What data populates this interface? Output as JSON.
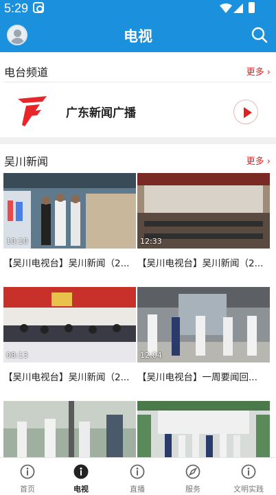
{
  "status_bar": {
    "time": "5:29"
  },
  "header": {
    "title": "电视"
  },
  "radio_section": {
    "title": "电台频道",
    "more": "更多",
    "channel": {
      "name": "广东新闻广播"
    }
  },
  "news_section": {
    "title": "吴川新闻",
    "more": "更多",
    "items": [
      {
        "duration": "10:10",
        "caption": "【吴川电视台】吴川新闻（2..."
      },
      {
        "duration": "12:33",
        "caption": "【吴川电视台】吴川新闻（2..."
      },
      {
        "duration": "08:13",
        "caption": "【吴川电视台】吴川新闻（2..."
      },
      {
        "duration": "12:04",
        "caption": "【吴川电视台】一周要闻回..."
      },
      {
        "duration": "",
        "caption": ""
      },
      {
        "duration": "",
        "caption": ""
      }
    ]
  },
  "tabs": [
    {
      "label": "首页",
      "icon": "info-icon"
    },
    {
      "label": "电视",
      "icon": "info-icon",
      "active": true
    },
    {
      "label": "直播",
      "icon": "info-icon"
    },
    {
      "label": "服务",
      "icon": "compass-icon"
    },
    {
      "label": "文明实践",
      "icon": "info-icon"
    }
  ],
  "colors": {
    "brand": "#1b90dc",
    "accent": "#e02020"
  }
}
